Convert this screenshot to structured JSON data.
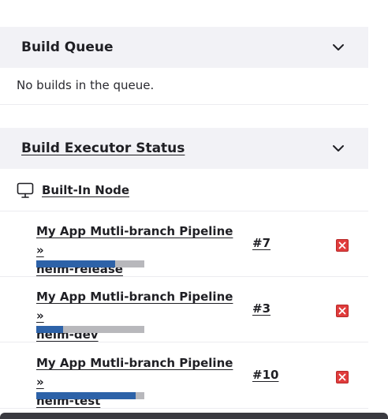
{
  "build_queue": {
    "title": "Build Queue",
    "empty_text": "No builds in the queue."
  },
  "executor_status": {
    "title": "Build Executor Status",
    "node": {
      "label": "Built-In Node",
      "icon": "computer-icon"
    },
    "executors": [
      {
        "job_line1": "My App Mutli-branch Pipeline »",
        "job_line2": "helm-release",
        "build": "#7",
        "progress": 0.73
      },
      {
        "job_line1": "My App Mutli-branch Pipeline »",
        "job_line2": "helm-dev",
        "build": "#3",
        "progress": 0.25
      },
      {
        "job_line1": "My App Mutli-branch Pipeline »",
        "job_line2": "helm-test",
        "build": "#10",
        "progress": 0.92
      }
    ]
  },
  "colors": {
    "header_bg": "#f2f2f6",
    "progress_fill": "#2d62a8",
    "progress_track": "#b8b8bc",
    "stop_button": "#e03c3c"
  }
}
